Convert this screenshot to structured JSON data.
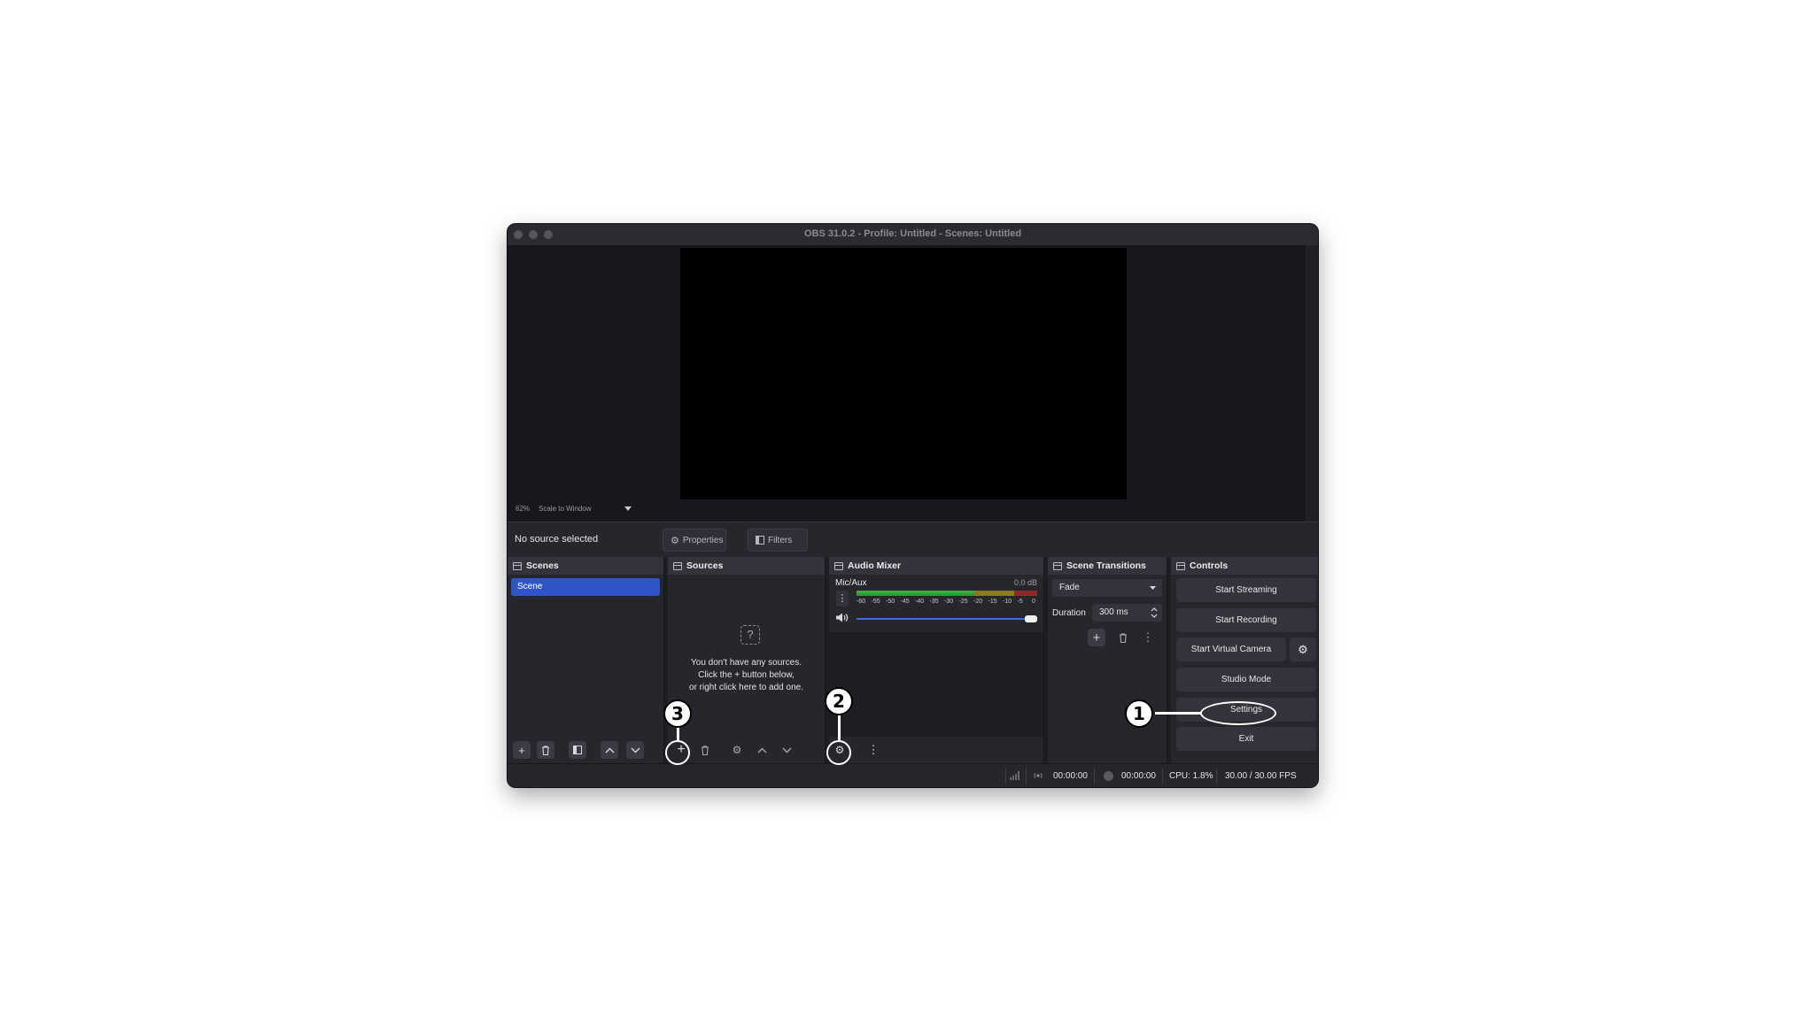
{
  "window": {
    "title": "OBS 31.0.2 - Profile: Untitled - Scenes: Untitled"
  },
  "preview": {
    "zoom": "62%",
    "scale_mode": "Scale to Window"
  },
  "context_bar": {
    "selection_label": "No source selected",
    "properties_label": "Properties",
    "filters_label": "Filters"
  },
  "scenes": {
    "title": "Scenes",
    "items": [
      "Scene"
    ]
  },
  "sources": {
    "title": "Sources",
    "empty_line1": "You don't have any sources.",
    "empty_line2": "Click the + button below,",
    "empty_line3": "or right click here to add one."
  },
  "audio_mixer": {
    "title": "Audio Mixer",
    "channel_name": "Mic/Aux",
    "channel_db": "0.0 dB",
    "meter_ticks": [
      "-60",
      "-55",
      "-50",
      "-45",
      "-40",
      "-35",
      "-30",
      "-25",
      "-20",
      "-15",
      "-10",
      "-5",
      "0"
    ],
    "volume_level": 1.0
  },
  "scene_transitions": {
    "title": "Scene Transitions",
    "transition": "Fade",
    "duration_label": "Duration",
    "duration_value": "300 ms"
  },
  "controls": {
    "title": "Controls",
    "start_streaming": "Start Streaming",
    "start_recording": "Start Recording",
    "start_virtual_camera": "Start Virtual Camera",
    "studio_mode": "Studio Mode",
    "settings": "Settings",
    "exit": "Exit"
  },
  "status": {
    "stream_time": "00:00:00",
    "record_time": "00:00:00",
    "cpu": "CPU: 1.8%",
    "fps": "30.00 / 30.00 FPS"
  },
  "callouts": [
    "1",
    "2",
    "3"
  ],
  "colors": {
    "accent": "#2f55c6",
    "window_bg": "#1d1e24",
    "meter_green": "#35b13f",
    "meter_yellow": "#b8a025",
    "meter_red": "#c23838",
    "volume_blue": "#3c6ce0"
  }
}
